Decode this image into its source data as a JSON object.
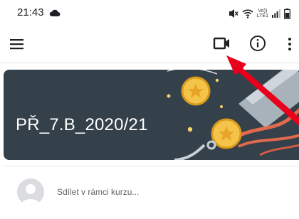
{
  "status_bar": {
    "time": "21:43",
    "volte_label_1": "Vo))",
    "volte_label_2": "LTE1",
    "icons": [
      "cloud-icon",
      "mute-icon",
      "wifi-icon",
      "volte-icon",
      "signal-icon",
      "battery-icon"
    ]
  },
  "toolbar": {
    "icons": [
      "menu-icon",
      "video-camera-icon",
      "info-icon",
      "more-vert-icon"
    ]
  },
  "course": {
    "title": "PŘ_7.B_2020/21",
    "banner_color": "#34404a"
  },
  "stream": {
    "share_placeholder": "Sdílet v rámci kurzu..."
  },
  "annotation": {
    "arrow_color": "#e8001c"
  }
}
